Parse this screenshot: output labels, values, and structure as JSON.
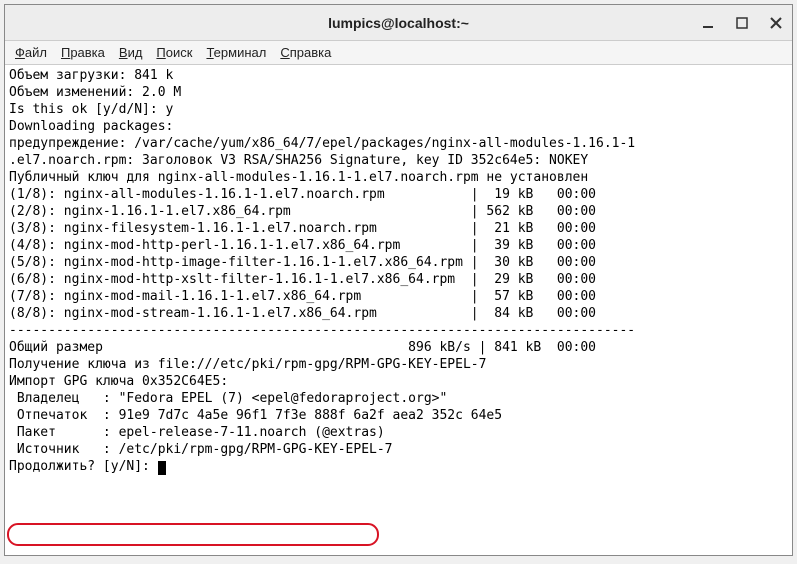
{
  "window": {
    "title": "lumpics@localhost:~"
  },
  "menu": {
    "file": "Файл",
    "edit": "Правка",
    "view": "Вид",
    "search": "Поиск",
    "terminal": "Терминал",
    "help": "Справка"
  },
  "term": {
    "l01": "Объем загрузки: 841 k",
    "l02": "Объем изменений: 2.0 M",
    "l03": "Is this ok [y/d/N]: y",
    "l04": "Downloading packages:",
    "l05": "предупреждение: /var/cache/yum/x86_64/7/epel/packages/nginx-all-modules-1.16.1-1",
    "l06": ".el7.noarch.rpm: Заголовок V3 RSA/SHA256 Signature, key ID 352c64e5: NOKEY",
    "l07": "Публичный ключ для nginx-all-modules-1.16.1-1.el7.noarch.rpm не установлен",
    "l08": "(1/8): nginx-all-modules-1.16.1-1.el7.noarch.rpm           |  19 kB   00:00",
    "l09": "(2/8): nginx-1.16.1-1.el7.x86_64.rpm                       | 562 kB   00:00",
    "l10": "(3/8): nginx-filesystem-1.16.1-1.el7.noarch.rpm            |  21 kB   00:00",
    "l11": "(4/8): nginx-mod-http-perl-1.16.1-1.el7.x86_64.rpm         |  39 kB   00:00",
    "l12": "(5/8): nginx-mod-http-image-filter-1.16.1-1.el7.x86_64.rpm |  30 kB   00:00",
    "l13": "(6/8): nginx-mod-http-xslt-filter-1.16.1-1.el7.x86_64.rpm  |  29 kB   00:00",
    "l14": "(7/8): nginx-mod-mail-1.16.1-1.el7.x86_64.rpm              |  57 kB   00:00",
    "l15": "(8/8): nginx-mod-stream-1.16.1-1.el7.x86_64.rpm            |  84 kB   00:00",
    "sep": "--------------------------------------------------------------------------------",
    "l17": "Общий размер                                       896 kB/s | 841 kB  00:00",
    "l18": "Получение ключа из file:///etc/pki/rpm-gpg/RPM-GPG-KEY-EPEL-7",
    "l19": "Импорт GPG ключа 0x352C64E5:",
    "l20": " Владелец   : \"Fedora EPEL (7) <epel@fedoraproject.org>\"",
    "l21": " Отпечаток  : 91e9 7d7c 4a5e 96f1 7f3e 888f 6a2f aea2 352c 64e5",
    "l22": " Пакет      : epel-release-7-11.noarch (@extras)",
    "l23": " Источник   : /etc/pki/rpm-gpg/RPM-GPG-KEY-EPEL-7",
    "prompt": "Продолжить? [y/N]: "
  }
}
